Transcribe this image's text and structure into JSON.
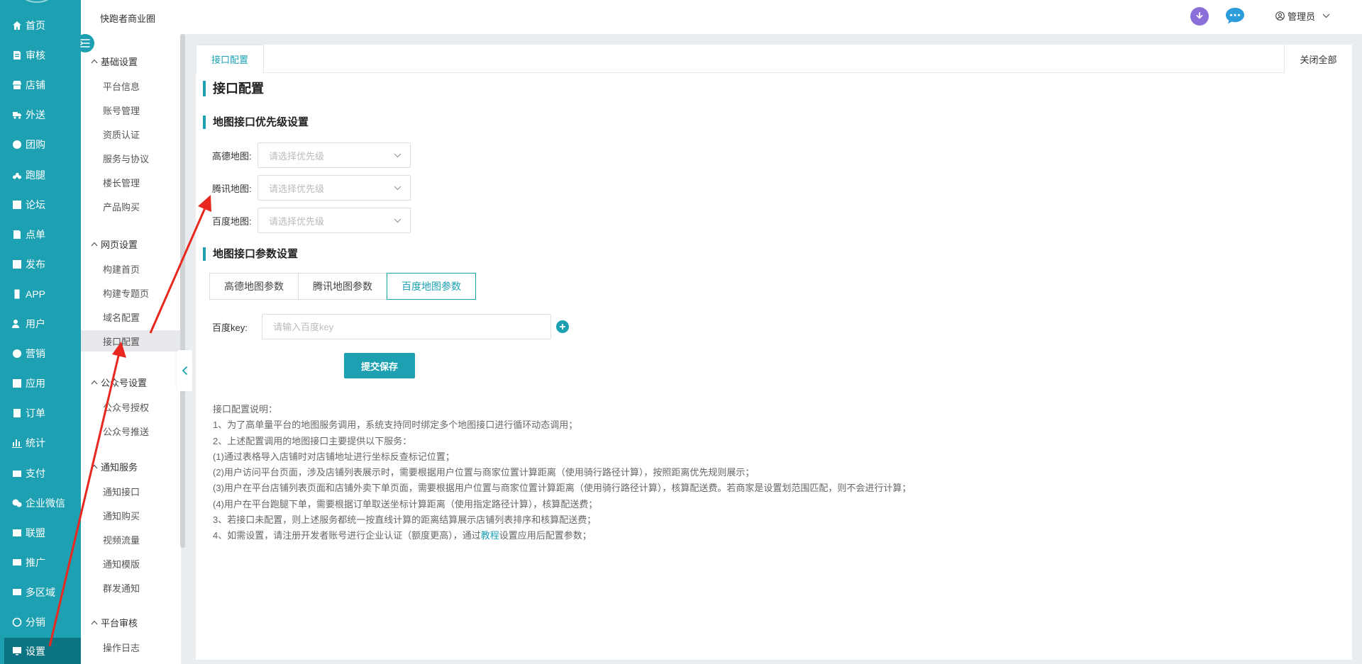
{
  "header": {
    "site_title": "快跑者商业圈",
    "user_name": "管理员",
    "icons": [
      "download-icon",
      "chat-bubble-icon",
      "user-icon",
      "chevron-down-icon"
    ],
    "download_color": "#8a6fd9",
    "chat_color": "#2d9cdb"
  },
  "leftnav": {
    "accent": "#1da1b2",
    "active_color": "#0b7382",
    "items": [
      {
        "label": "首页",
        "icon": "home-icon"
      },
      {
        "label": "审核",
        "icon": "audit-icon"
      },
      {
        "label": "店铺",
        "icon": "store-icon"
      },
      {
        "label": "外送",
        "icon": "delivery-icon"
      },
      {
        "label": "团购",
        "icon": "group-buy-icon"
      },
      {
        "label": "跑腿",
        "icon": "errand-icon"
      },
      {
        "label": "论坛",
        "icon": "forum-icon"
      },
      {
        "label": "点单",
        "icon": "order-menu-icon"
      },
      {
        "label": "发布",
        "icon": "publish-icon"
      },
      {
        "label": "APP",
        "icon": "phone-icon"
      },
      {
        "label": "用户",
        "icon": "users-icon"
      },
      {
        "label": "营销",
        "icon": "marketing-icon"
      },
      {
        "label": "应用",
        "icon": "apps-icon"
      },
      {
        "label": "订单",
        "icon": "orders-icon"
      },
      {
        "label": "统计",
        "icon": "stats-icon"
      },
      {
        "label": "支付",
        "icon": "payment-icon"
      },
      {
        "label": "企业微信",
        "icon": "wechat-icon"
      },
      {
        "label": "联盟",
        "icon": "alliance-icon"
      },
      {
        "label": "推广",
        "icon": "promotion-icon"
      },
      {
        "label": "多区域",
        "icon": "regions-icon"
      },
      {
        "label": "分销",
        "icon": "distribution-icon"
      },
      {
        "label": "设置",
        "icon": "monitor-icon"
      }
    ]
  },
  "subnav": {
    "groups": [
      {
        "title": "基础设置",
        "items": [
          "平台信息",
          "账号管理",
          "资质认证",
          "服务与协议",
          "楼长管理",
          "产品购买"
        ]
      },
      {
        "title": "网页设置",
        "items": [
          "构建首页",
          "构建专题页",
          "域名配置",
          "接口配置"
        ]
      },
      {
        "title": "公众号设置",
        "items": [
          "公众号授权",
          "公众号推送"
        ]
      },
      {
        "title": "通知服务",
        "items": [
          "通知接口",
          "通知购买",
          "视频流量",
          "通知模版",
          "群发通知"
        ]
      },
      {
        "title": "平台审核",
        "items": [
          "操作日志"
        ]
      }
    ]
  },
  "tabs": {
    "active": "接口配置",
    "close_all": "关闭全部"
  },
  "content": {
    "page_title": "接口配置",
    "priority_section": {
      "title": "地图接口优先级设置",
      "rows": [
        {
          "label": "高德地图:",
          "placeholder": "请选择优先级"
        },
        {
          "label": "腾讯地图:",
          "placeholder": "请选择优先级"
        },
        {
          "label": "百度地图:",
          "placeholder": "请选择优先级"
        }
      ]
    },
    "param_section": {
      "title": "地图接口参数设置",
      "tabs": [
        "高德地图参数",
        "腾讯地图参数",
        "百度地图参数"
      ],
      "active_tab": 2,
      "key_label": "百度key:",
      "key_placeholder": "请输入百度key",
      "submit": "提交保存"
    },
    "notes": {
      "lines": [
        "接口配置说明：",
        "1、为了高单量平台的地图服务调用，系统支持同时绑定多个地图接口进行循环动态调用；",
        "2、上述配置调用的地图接口主要提供以下服务：",
        "(1)通过表格导入店铺时对店铺地址进行坐标反查标记位置；",
        "(2)用户访问平台页面，涉及店铺列表展示时，需要根据用户位置与商家位置计算距离（使用骑行路径计算），按照距离优先规则展示；",
        "(3)用户在平台店铺列表页面和店铺外卖下单页面，需要根据用户位置与商家位置计算距离（使用骑行路径计算），核算配送费。若商家是设置划范围匹配，则不会进行计算；",
        "(4)用户在平台跑腿下单，需要根据订单取送坐标计算距离（使用指定路径计算），核算配送费；",
        "3、若接口未配置，则上述服务都统一按直线计算的距离结算展示店铺列表排序和核算配送费；"
      ],
      "last_before": "4、如需设置，请注册开发者账号进行企业认证（额度更高），通过",
      "last_link": "教程",
      "last_after": "设置应用后配置参数；"
    }
  }
}
